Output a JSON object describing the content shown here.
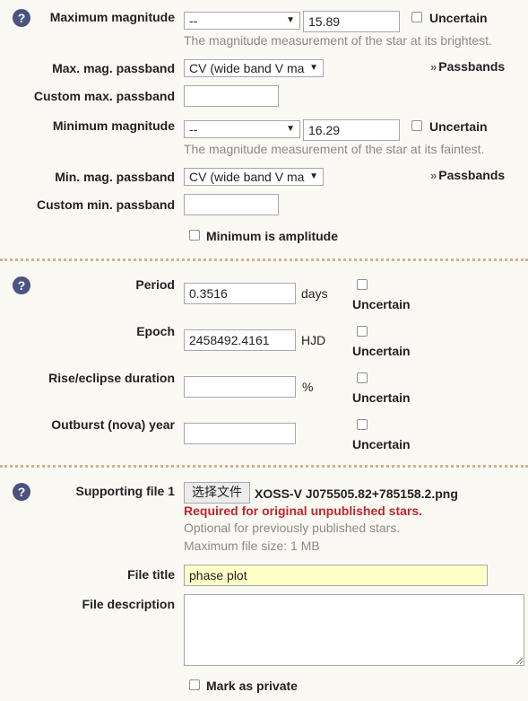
{
  "magnitude": {
    "help_icon": "question-icon",
    "max": {
      "label": "Maximum magnitude",
      "operator_value": "--",
      "value": "15.89",
      "uncertain_label": "Uncertain",
      "hint": "The magnitude measurement of the star at its brightest."
    },
    "max_passband": {
      "label": "Max. mag. passband",
      "value": "CV (wide band V ma",
      "link_label": "Passbands"
    },
    "custom_max_passband": {
      "label": "Custom max. passband",
      "value": ""
    },
    "min": {
      "label": "Minimum magnitude",
      "operator_value": "--",
      "value": "16.29",
      "uncertain_label": "Uncertain",
      "hint": "The magnitude measurement of the star at its faintest."
    },
    "min_passband": {
      "label": "Min. mag. passband",
      "value": "CV (wide band V ma",
      "link_label": "Passbands"
    },
    "custom_min_passband": {
      "label": "Custom min. passband",
      "value": ""
    },
    "min_is_amplitude_label": "Minimum is amplitude"
  },
  "timing": {
    "period": {
      "label": "Period",
      "value": "0.3516",
      "unit": "days",
      "uncertain_label": "Uncertain"
    },
    "epoch": {
      "label": "Epoch",
      "value": "2458492.4161",
      "unit": "HJD",
      "uncertain_label": "Uncertain"
    },
    "rise": {
      "label": "Rise/eclipse duration",
      "value": "",
      "unit": "%",
      "uncertain_label": "Uncertain"
    },
    "outburst": {
      "label": "Outburst (nova) year",
      "value": "",
      "unit": "",
      "uncertain_label": "Uncertain"
    }
  },
  "file": {
    "label": "Supporting file 1",
    "choose_button": "选择文件",
    "file_name": "XOSS-V J075505.82+785158.2.png",
    "required_text": "Required for original unpublished stars.",
    "optional_text": "Optional for previously published stars.",
    "max_size_text": "Maximum file size: 1 MB",
    "title_label": "File title",
    "title_value": "phase plot",
    "description_label": "File description",
    "description_value": "",
    "private_label": "Mark as private"
  },
  "colors": {
    "background": "#fbf9f4",
    "help_icon": "#4a5382",
    "divider": "#d7b08c",
    "required_text": "#c0262d",
    "title_input_bg": "#ffffc8"
  }
}
